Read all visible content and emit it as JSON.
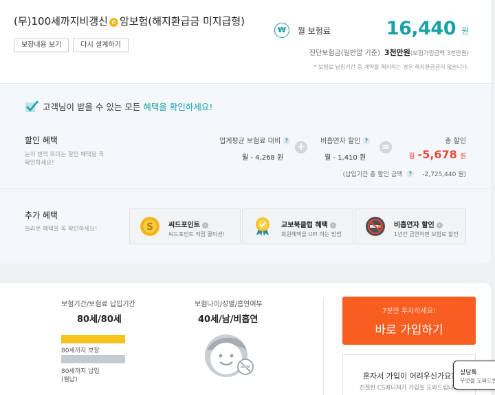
{
  "product": {
    "title_before": "(무)100세까지비갱신",
    "title_icon": "coin-icon",
    "title_icon_glyph": "e",
    "title_after": "암보험(해지환급금 미지급형)",
    "buttons": {
      "coverage": "보장내용 보기",
      "redesign": "다시 설계하기"
    }
  },
  "premium": {
    "icon_glyph": "₩",
    "label": "월 보험료",
    "amount": "16,440",
    "unit": "원",
    "sum_label": "진단보험금(일반암 기준)",
    "sum_value": "3천만원",
    "sum_sub": "(보험가입금액 3천만원)",
    "note": "* 보험료 납입기간 중 계약을 해지하는 경우 해지환급금이 없습니다."
  },
  "benefits": {
    "headline_before": "고객님이 받을 수 있는 모든",
    "headline_highlight": "혜택을 확인하세요!",
    "discount": {
      "title": "할인 혜택",
      "desc": "눈이 번쩍 뜨이는 할인 혜택을 꼭 확인하세요!",
      "industry_label": "업계평균 보험료 대비",
      "industry_value": "월 - 4,268 원",
      "plus": "+",
      "nonsmoker_label": "비흡연자 할인",
      "nonsmoker_value": "월 - 1,410 원",
      "equals": "=",
      "total_label": "총 할인",
      "total_prefix": "월",
      "total_value": "-5,678",
      "total_unit": "원",
      "period_label": "(납입기간 총 할인 금액",
      "period_value": "-2,725,440 원)",
      "help": "?"
    },
    "extra": {
      "title": "추가 혜택",
      "desc": "놀라운 혜택을 꼭 확인하세요!",
      "items": [
        {
          "name": "씨드포인트",
          "desc": "씨드포인트 적립 꿀미션!",
          "icon": "seed-coin-icon"
        },
        {
          "name": "교보북클럽 혜택",
          "desc": "회원혜택을 UP! 하는 방법",
          "icon": "medal-icon"
        },
        {
          "name": "비흡연자 할인",
          "desc": "1년간 금연하면 보험료 할인",
          "icon": "no-smoking-icon"
        }
      ]
    }
  },
  "summary": {
    "period_label": "보험기간/보험료 납입기간",
    "period_value": "80세/80세",
    "coverage_bar_label": "80세까지 보장",
    "payment_bar_label": "80세까지 납입",
    "payment_bar_sub": "(월납)",
    "person_label": "보험나이/성별/흡연여부",
    "person_value": "40세/남/비흡연"
  },
  "cta": {
    "small": "7분만 투자하세요!",
    "big": "바로 가입하기"
  },
  "help": {
    "title": "혼자서 가입이 어려우신가요?",
    "desc": "친절한 CS매니저가 가입을 도와드립니다"
  },
  "chat": {
    "title": "상담톡",
    "desc": "무엇을 도와드릴까요"
  },
  "colors": {
    "accent": "#1aa1a8",
    "discount": "#e8483b",
    "cta": "#f85e22",
    "bar_coverage": "#f5c319",
    "bar_payment": "#c6cbcf"
  }
}
